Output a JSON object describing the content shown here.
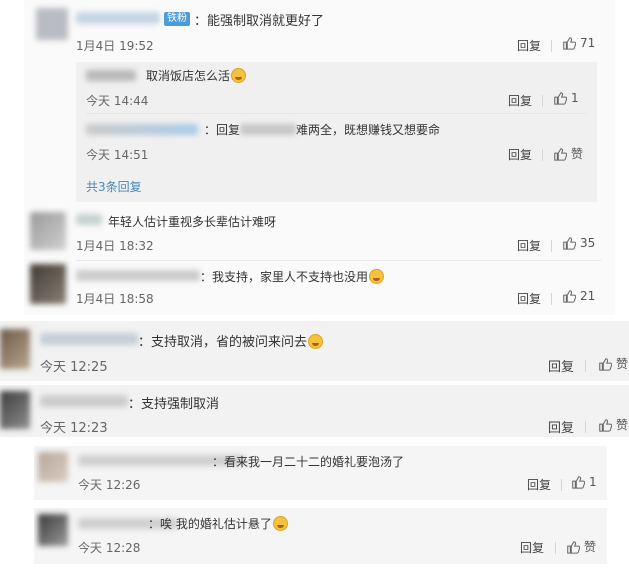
{
  "labels": {
    "reply": "回复",
    "like": "赞"
  },
  "comments": [
    {
      "text": "：能强制取消就更好了",
      "badge": "铁粉",
      "time": "1月4日 19:52",
      "likes": "71"
    },
    {
      "text": "取消饭店怎么活",
      "time": "今天 14:44",
      "likes": "1"
    },
    {
      "prefix": "：回复",
      "text": "难两全，既想赚钱又想要命",
      "time": "今天 14:51",
      "likes": "赞"
    },
    {
      "more": "共3条回复"
    },
    {
      "text": "年轻人估计重视多长辈估计难呀",
      "time": "1月4日 18:32",
      "likes": "35"
    },
    {
      "text": "：我支持，家里人不支持也没用",
      "time": "1月4日 18:58",
      "likes": "21"
    },
    {
      "text": "：支持取消，省的被问来问去",
      "time": "今天 12:25",
      "likes": "赞"
    },
    {
      "text": "：支持强制取消",
      "time": "今天 12:23",
      "likes": "赞"
    },
    {
      "text": "：看来我一月二十二的婚礼要泡汤了",
      "time": "今天 12:26",
      "likes": "1"
    },
    {
      "text": "：唉 我的婚礼估计悬了",
      "time": "今天 12:28",
      "likes": "赞"
    }
  ]
}
